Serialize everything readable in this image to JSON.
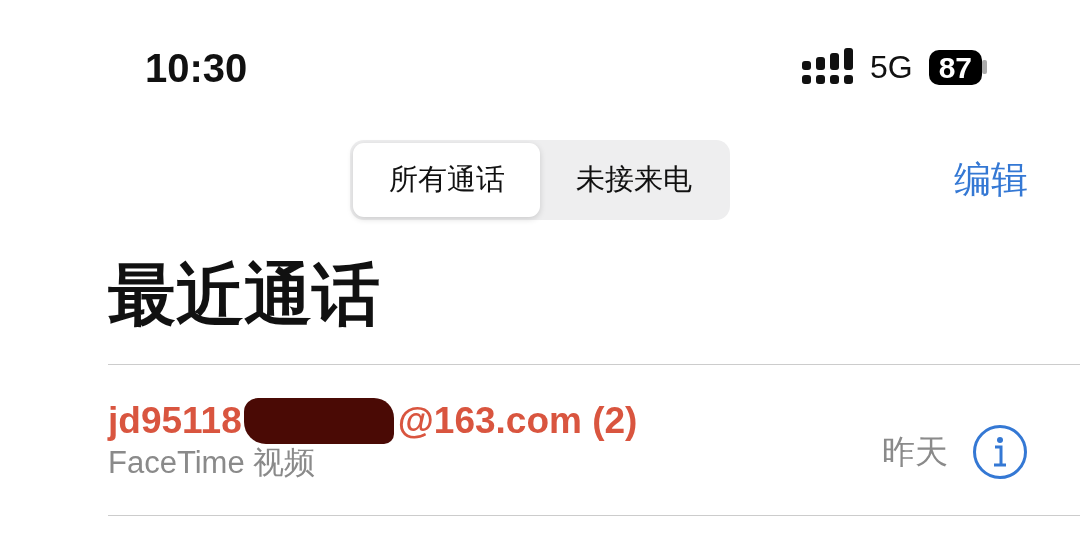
{
  "status_bar": {
    "time": "10:30",
    "network": "5G",
    "battery": "87"
  },
  "tabs": [
    {
      "label": "所有通话",
      "selected": true
    },
    {
      "label": "未接来电",
      "selected": false
    }
  ],
  "edit_button": "编辑",
  "title": "最近通话",
  "calls": [
    {
      "name_start": "jd95118",
      "name_end": "@163.com (2)",
      "redacted": true,
      "missed": true,
      "type": "FaceTime 视频",
      "date": "昨天"
    }
  ]
}
